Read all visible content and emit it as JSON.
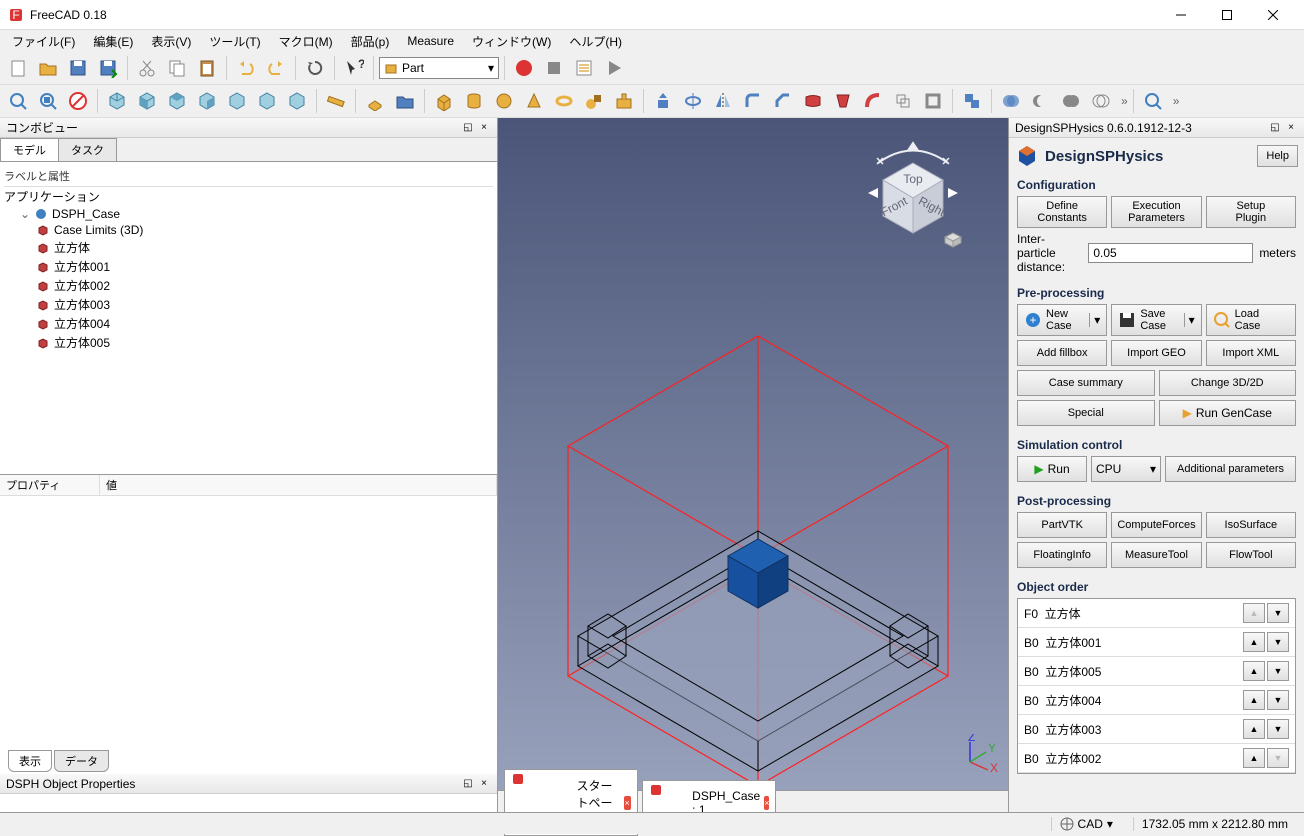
{
  "title": "FreeCAD 0.18",
  "menubar": [
    "ファイル(F)",
    "編集(E)",
    "表示(V)",
    "ツール(T)",
    "マクロ(M)",
    "部品(p)",
    "Measure",
    "ウィンドウ(W)",
    "ヘルプ(H)"
  ],
  "workbench": "Part",
  "left_panel": {
    "title": "コンボビュー",
    "tabs": [
      "モデル",
      "タスク"
    ],
    "tree_header": "ラベルと属性",
    "app_label": "アプリケーション",
    "case": "DSPH_Case",
    "items": [
      "Case Limits (3D)",
      "立方体",
      "立方体001",
      "立方体002",
      "立方体003",
      "立方体004",
      "立方体005"
    ],
    "prop_cols": [
      "プロパティ",
      "値"
    ],
    "bottom_tabs": [
      "表示",
      "データ"
    ],
    "dsph_props": "DSPH Object Properties"
  },
  "doc_tabs": [
    {
      "label": "スタートページ"
    },
    {
      "label": "DSPH_Case : 1"
    }
  ],
  "dsph": {
    "panel_title": "DesignSPHysics 0.6.0.1912-12-3",
    "brand": "DesignSPHysics",
    "help": "Help",
    "config_title": "Configuration",
    "config_btns": [
      "Define\nConstants",
      "Execution\nParameters",
      "Setup\nPlugin"
    ],
    "ipd_label": "Inter-particle distance:",
    "ipd_value": "0.05",
    "ipd_unit": "meters",
    "pre_title": "Pre-processing",
    "new_case": "New\nCase",
    "save_case": "Save\nCase",
    "load_case": "Load\nCase",
    "pre_row2": [
      "Add fillbox",
      "Import GEO",
      "Import XML"
    ],
    "pre_row3": [
      "Case summary",
      "Change 3D/2D"
    ],
    "pre_row4": [
      "Special",
      "Run GenCase"
    ],
    "sim_title": "Simulation control",
    "run": "Run",
    "cpu": "CPU",
    "add_params": "Additional parameters",
    "post_title": "Post-processing",
    "post_row1": [
      "PartVTK",
      "ComputeForces",
      "IsoSurface"
    ],
    "post_row2": [
      "FloatingInfo",
      "MeasureTool",
      "FlowTool"
    ],
    "order_title": "Object order",
    "order": [
      {
        "tag": "F0",
        "name": "立方体",
        "up_disabled": true,
        "down_disabled": false
      },
      {
        "tag": "B0",
        "name": "立方体001",
        "up_disabled": false,
        "down_disabled": false
      },
      {
        "tag": "B0",
        "name": "立方体005",
        "up_disabled": false,
        "down_disabled": false
      },
      {
        "tag": "B0",
        "name": "立方体004",
        "up_disabled": false,
        "down_disabled": false
      },
      {
        "tag": "B0",
        "name": "立方体003",
        "up_disabled": false,
        "down_disabled": false
      },
      {
        "tag": "B0",
        "name": "立方体002",
        "up_disabled": false,
        "down_disabled": true
      }
    ]
  },
  "status": {
    "mode": "CAD",
    "coords": "1732.05 mm x 2212.80 mm"
  }
}
